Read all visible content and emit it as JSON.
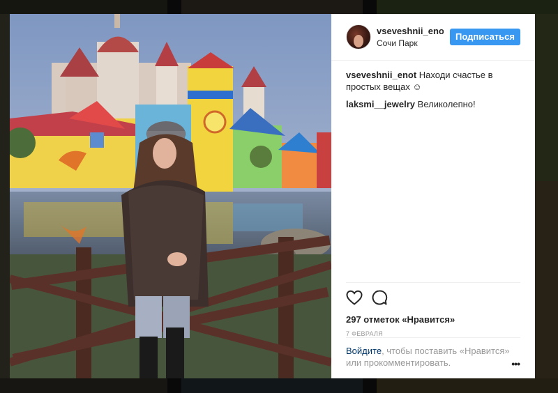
{
  "post": {
    "author": {
      "username": "vseveshnii_enot",
      "location": "Сочи Парк"
    },
    "follow_label": "Подписаться",
    "caption": {
      "username": "vseveshnii_enot",
      "text": "Находи счастье в простых вещах ☺"
    },
    "comments": [
      {
        "username": "laksmi__jewelry",
        "text": "Великолепно!"
      }
    ],
    "likes_text": "297 отметок «Нравится»",
    "date": "7 ФЕВРАЛЯ",
    "login_prompt": {
      "link": "Войдите",
      "rest": ", чтобы поставить «Нравится» или прокомментировать."
    },
    "more_label": "•••"
  },
  "icons": {
    "like": "heart-icon",
    "comment": "comment-bubble-icon",
    "more": "more-options-icon"
  },
  "colors": {
    "follow_button": "#3897f0",
    "link": "#003569",
    "muted_text": "#999999"
  }
}
